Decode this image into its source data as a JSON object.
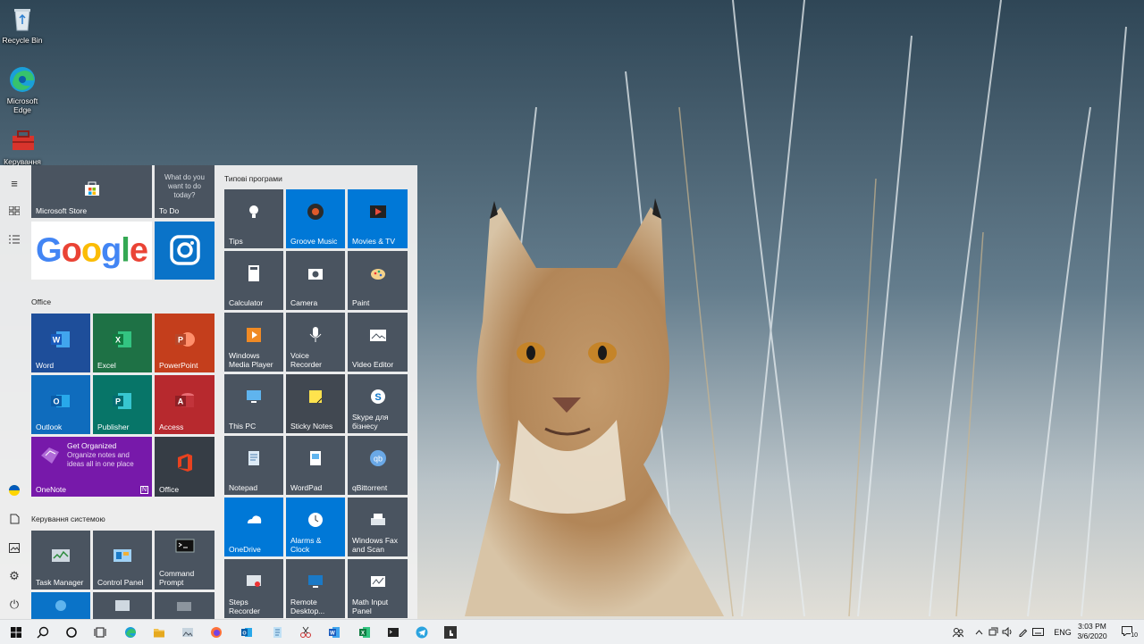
{
  "desktop": {
    "icons": [
      {
        "label": "Recycle Bin",
        "icon": "recycle-bin-icon"
      },
      {
        "label": "Microsoft Edge",
        "icon": "edge-icon"
      },
      {
        "label": "Керування",
        "icon": "toolbox-icon"
      }
    ]
  },
  "start_menu": {
    "rail": [
      "hamburger-menu-icon",
      "tiles-view-icon",
      "all-apps-list-icon",
      "ukraine-flag-icon",
      "documents-icon",
      "pictures-icon",
      "settings-icon",
      "power-icon"
    ],
    "top_tiles": {
      "store": "Microsoft Store",
      "todo_hint": "What do you want to do today?",
      "todo": "To Do",
      "google": "Google"
    },
    "office_group": {
      "title": "Office",
      "tiles": [
        "Word",
        "Excel",
        "PowerPoint",
        "Outlook",
        "Publisher",
        "Access"
      ],
      "onenote": {
        "label": "OneNote",
        "headline": "Get Organized",
        "desc": "Organize notes and ideas all in one place"
      },
      "office": "Office"
    },
    "system_group": {
      "title": "Керування системою",
      "tiles": [
        "Task Manager",
        "Control Panel",
        "Command Prompt"
      ]
    },
    "apps_group": {
      "title": "Типові програми",
      "tiles": [
        "Tips",
        "Groove Music",
        "Movies & TV",
        "Calculator",
        "Camera",
        "Paint",
        "Windows Media Player",
        "Voice Recorder",
        "Video Editor",
        "This PC",
        "Sticky Notes",
        "Skype для бізнесу",
        "Notepad",
        "WordPad",
        "qBittorrent",
        "OneDrive",
        "Alarms & Clock",
        "Windows Fax and Scan",
        "Steps Recorder",
        "Remote Desktop...",
        "Math Input Panel"
      ]
    }
  },
  "taskbar": {
    "pinned": [
      "windows-start-icon",
      "search-icon",
      "cortana-icon",
      "task-view-icon",
      "edge-icon",
      "file-explorer-icon",
      "photo-viewer-icon",
      "firefox-icon",
      "outlook-icon",
      "notepad-icon",
      "snipping-tool-icon",
      "word-icon",
      "excel-icon",
      "terminal-icon",
      "telegram-icon",
      "touch-app-icon"
    ],
    "language": "ENG",
    "time": "3:03 PM",
    "date": "3/6/2020",
    "notifications": "10"
  },
  "colors": {
    "accent": "#0078d7",
    "tile_gray": "#4a5460",
    "word": "#1e4e9a",
    "excel": "#1e7145",
    "powerpoint": "#c43e1c",
    "outlook": "#0f6cbd",
    "publisher": "#077568",
    "access": "#b7292e",
    "onenote": "#7719aa",
    "office": "#363d45"
  }
}
